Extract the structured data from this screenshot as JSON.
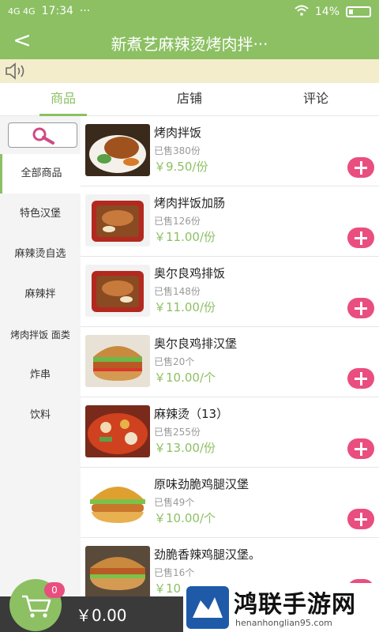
{
  "status_bar": {
    "time": "17:34",
    "dots": "···",
    "carrier": "4G 4G",
    "battery": "14%"
  },
  "header": {
    "back": "<",
    "title": "新煮艺麻辣烫烤肉拌···"
  },
  "tabs": [
    {
      "label": "商品",
      "active": true
    },
    {
      "label": "店铺",
      "active": false
    },
    {
      "label": "评论",
      "active": false
    }
  ],
  "sidebar": {
    "categories": [
      "全部商品",
      "特色汉堡",
      "麻辣烫自选",
      "麻辣拌",
      "烤肉拌饭 面类",
      "炸串",
      "饮料"
    ]
  },
  "products": [
    {
      "name": "烤肉拌饭",
      "sold": "已售380份",
      "price": "￥9.50/份",
      "image": "rice-bowl"
    },
    {
      "name": "烤肉拌饭加肠",
      "sold": "已售126份",
      "price": "￥11.00/份",
      "image": "rice-tray"
    },
    {
      "name": "奥尔良鸡排饭",
      "sold": "已售148份",
      "price": "￥11.00/份",
      "image": "rice-tray"
    },
    {
      "name": "奥尔良鸡排汉堡",
      "sold": "已售20个",
      "price": "￥10.00/个",
      "image": "burger"
    },
    {
      "name": "麻辣烫（13）",
      "sold": "已售255份",
      "price": "￥13.00/份",
      "image": "hotpot"
    },
    {
      "name": "原味劲脆鸡腿汉堡",
      "sold": "已售49个",
      "price": "￥10.00/个",
      "image": "burger"
    },
    {
      "name": "劲脆香辣鸡腿汉堡。",
      "sold": "已售16个",
      "price": "￥10",
      "image": "burger"
    }
  ],
  "cart": {
    "count": "0",
    "total": "￥0.00"
  },
  "watermark": {
    "text": "鸿联手游网",
    "url": "henanhonglian95.com"
  },
  "colors": {
    "accent": "#8cc063",
    "add_button": "#e94e7f",
    "notice_bg": "#f3edcc",
    "cart_bar": "#3a3a3a"
  }
}
